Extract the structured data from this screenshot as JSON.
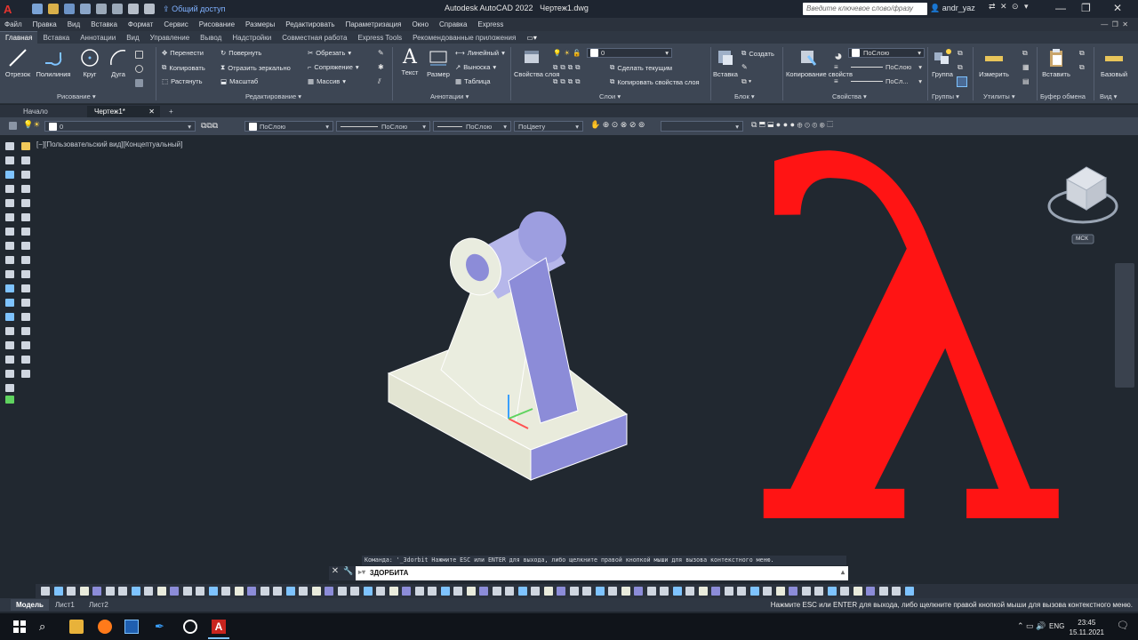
{
  "titlebar": {
    "app_name": "Autodesk AutoCAD 2022",
    "file_name": "Чертеж1.dwg",
    "share_label": "Общий доступ",
    "search_placeholder": "Введите ключевое слово/фразу",
    "user": "andr_yaz"
  },
  "menubar": [
    "Файл",
    "Правка",
    "Вид",
    "Вставка",
    "Формат",
    "Сервис",
    "Рисование",
    "Размеры",
    "Редактировать",
    "Параметризация",
    "Окно",
    "Справка",
    "Express"
  ],
  "ribbon_tabs": [
    "Главная",
    "Вставка",
    "Аннотации",
    "Вид",
    "Управление",
    "Вывод",
    "Надстройки",
    "Совместная работа",
    "Express Tools",
    "Рекомендованные приложения"
  ],
  "ribbon": {
    "draw": {
      "line": "Отрезок",
      "polyline": "Полилиния",
      "circle": "Круг",
      "arc": "Дуга",
      "title": "Рисование"
    },
    "modify": {
      "move": "Перенести",
      "rotate": "Повернуть",
      "trim": "Обрезать",
      "copy": "Копировать",
      "mirror": "Отразить зеркально",
      "fillet": "Сопряжение",
      "stretch": "Растянуть",
      "scale": "Масштаб",
      "array": "Массив",
      "title": "Редактирование"
    },
    "annotation": {
      "text": "Текст",
      "dimension": "Размер",
      "linear": "Линейный",
      "leader": "Выноска",
      "table": "Таблица",
      "title": "Аннотации"
    },
    "layers": {
      "props": "Свойства слоя",
      "current_layer": "0",
      "make_current": "Сделать текущим",
      "copy_props": "Копировать свойства слоя",
      "title": "Слои"
    },
    "block": {
      "insert": "Вставка",
      "create": "Создать",
      "title": "Блок"
    },
    "properties": {
      "copy": "Копирование свойств",
      "bylayer1": "ПоСлою",
      "bylayer2": "ПоСлою",
      "bylayer3": "ПоСл...",
      "title": "Свойства"
    },
    "groups": {
      "group": "Группа",
      "title": "Группы"
    },
    "utilities": {
      "measure": "Измерить",
      "title": "Утилиты"
    },
    "clipboard": {
      "paste": "Вставить",
      "title": "Буфер обмена"
    },
    "view": {
      "base": "Базовый",
      "title": "Вид"
    }
  },
  "doc_tabs": {
    "start": "Начало",
    "drawing": "Чертеж1*"
  },
  "prop_toolbar": {
    "layer": "0",
    "color": "ПоСлою",
    "linetype": "ПоСлою",
    "lineweight": "ПоСлою",
    "plotstyle": "ПоЦвету"
  },
  "viewport": {
    "label": "[−][Пользовательский вид][Концептуальный]",
    "ucs_label": "МСК"
  },
  "command": {
    "history": "Команда: '_3dorbit Нажмите ESC или ENTER для выхода, либо щелкните правой кнопкой мыши для вызова контекстного меню.",
    "input": "3ДОРБИТА"
  },
  "layout_tabs": [
    "Модель",
    "Лист1",
    "Лист2"
  ],
  "status_message": "Нажмите ESC или ENTER для выхода, либо щелкните правой кнопкой мыши для вызова контекстного меню.",
  "taskbar": {
    "lang": "ENG",
    "time": "23:45",
    "date": "15.11.2021"
  },
  "overlay_symbol": "λ",
  "colors": {
    "accent_red": "#ff1414",
    "model_face_light": "#e8eadc",
    "model_face_blue": "#8c8cd8"
  }
}
